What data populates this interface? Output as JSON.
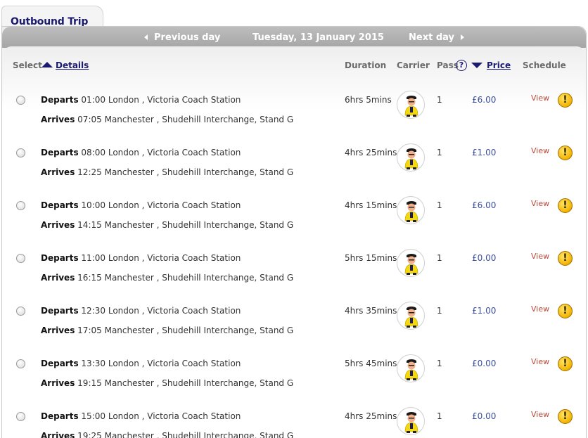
{
  "tab": {
    "title": "Outbound Trip"
  },
  "nav": {
    "previous_label": "Previous day",
    "date": "Tuesday, 13 January 2015",
    "next_label": "Next day"
  },
  "columns": {
    "select": "Select",
    "details": "Details",
    "duration": "Duration",
    "carrier": "Carrier",
    "pass": "Pass",
    "help": "?",
    "price": "Price",
    "schedule": "Schedule"
  },
  "labels": {
    "departs": "Departs",
    "arrives": "Arrives",
    "view": "View",
    "warning": "!"
  },
  "colors": {
    "accent": "#1a1a6e",
    "price": "#3a4fa0",
    "view_link": "#b94a3a",
    "warning": "#f2b300"
  },
  "carrier_icon": "coach-driver-mascot-icon",
  "trips": [
    {
      "dep_time": "01:00",
      "dep_place": "London , Victoria Coach Station",
      "arr_time": "07:05",
      "arr_place": "Manchester , Shudehill Interchange, Stand G",
      "duration": "6hrs 5mins",
      "pass": "1",
      "price": "£6.00"
    },
    {
      "dep_time": "08:00",
      "dep_place": "London , Victoria Coach Station",
      "arr_time": "12:25",
      "arr_place": "Manchester , Shudehill Interchange, Stand G",
      "duration": "4hrs 25mins",
      "pass": "1",
      "price": "£1.00"
    },
    {
      "dep_time": "10:00",
      "dep_place": "London , Victoria Coach Station",
      "arr_time": "14:15",
      "arr_place": "Manchester , Shudehill Interchange, Stand G",
      "duration": "4hrs 15mins",
      "pass": "1",
      "price": "£6.00"
    },
    {
      "dep_time": "11:00",
      "dep_place": "London , Victoria Coach Station",
      "arr_time": "16:15",
      "arr_place": "Manchester , Shudehill Interchange, Stand G",
      "duration": "5hrs 15mins",
      "pass": "1",
      "price": "£0.00"
    },
    {
      "dep_time": "12:30",
      "dep_place": "London , Victoria Coach Station",
      "arr_time": "17:05",
      "arr_place": "Manchester , Shudehill Interchange, Stand G",
      "duration": "4hrs 35mins",
      "pass": "1",
      "price": "£1.00"
    },
    {
      "dep_time": "13:30",
      "dep_place": "London , Victoria Coach Station",
      "arr_time": "19:15",
      "arr_place": "Manchester , Shudehill Interchange, Stand G",
      "duration": "5hrs 45mins",
      "pass": "1",
      "price": "£0.00"
    },
    {
      "dep_time": "15:00",
      "dep_place": "London , Victoria Coach Station",
      "arr_time": "19:25",
      "arr_place": "Manchester , Shudehill Interchange, Stand G",
      "duration": "4hrs 25mins",
      "pass": "1",
      "price": "£0.00"
    }
  ]
}
